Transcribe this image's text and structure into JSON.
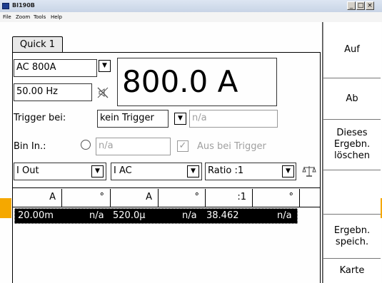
{
  "window": {
    "title": "BI190B",
    "controls": {
      "minimize": "_",
      "maximize": "□",
      "close": "×"
    }
  },
  "menu": {
    "items": [
      "File",
      "Zoom",
      "Tools",
      "Help"
    ]
  },
  "tabs": [
    {
      "label": "Quick 1",
      "active": true
    }
  ],
  "measurement": {
    "range_select": "AC 800A",
    "frequency": "50.00 Hz",
    "big_value": "800.0 A"
  },
  "trigger": {
    "label": "Trigger bei:",
    "select_value": "kein Trigger",
    "value": "n/a"
  },
  "bin_input": {
    "label": "Bin In.:",
    "value": "n/a",
    "checkbox_label": "Aus bei Trigger",
    "checkbox_checked": true
  },
  "selectors": {
    "output": "I Out",
    "ac": "I AC",
    "ratio": "Ratio :1"
  },
  "table": {
    "headers": [
      "A",
      "°",
      "A",
      "°",
      ":1",
      "°"
    ],
    "rows": [
      [
        "20.00m",
        "n/a",
        "520.0µ",
        "n/a",
        "38.462",
        "n/a"
      ]
    ]
  },
  "sidebar": {
    "buttons": [
      "Auf",
      "Ab",
      "Dieses Ergebn. löschen",
      "",
      "Ergebn. speich.",
      "Karte"
    ]
  },
  "icons": {
    "app": "app-icon",
    "mute": "speaker-mute-icon",
    "balance": "scale-icon",
    "dropdown": "dropdown-arrow-icon"
  },
  "colors": {
    "accent_yellow": "#f5a800",
    "selected_row_bg": "#000000",
    "selected_row_fg": "#ffffff"
  }
}
